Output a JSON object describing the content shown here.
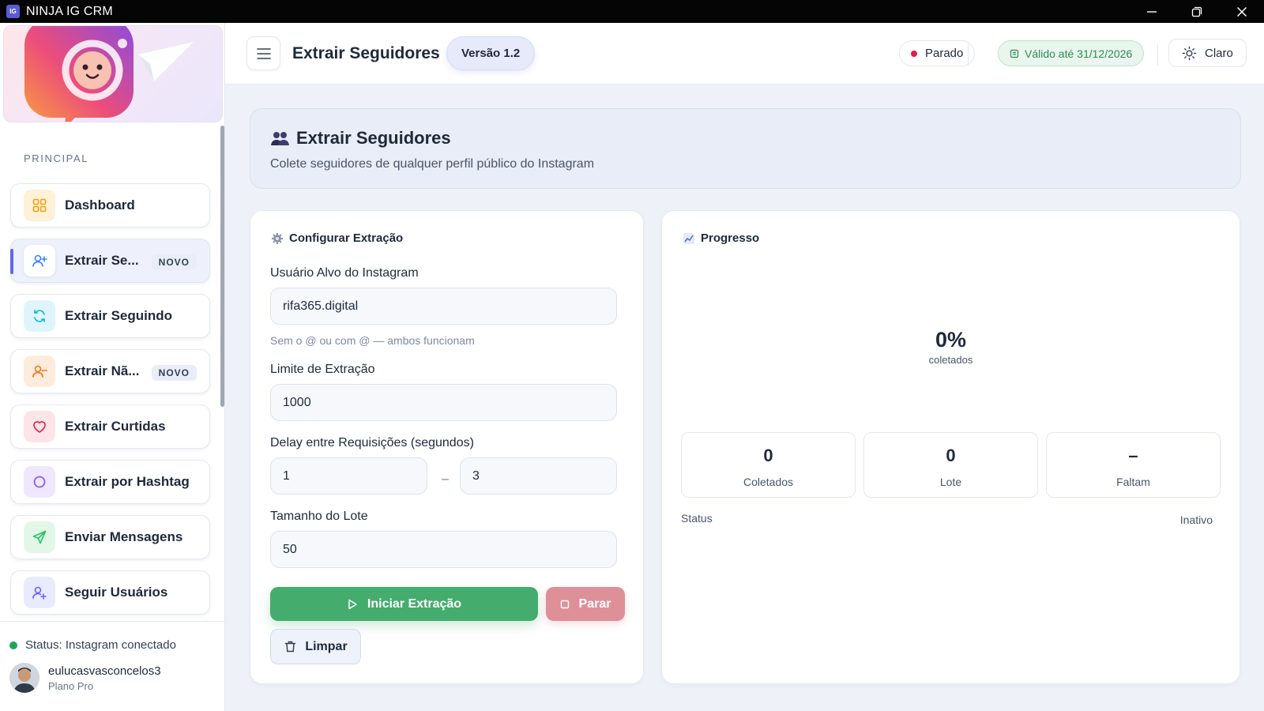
{
  "window": {
    "title": "NINJA IG CRM",
    "logo_text": "IG"
  },
  "sidebar": {
    "section_label": "PRINCIPAL",
    "items": [
      {
        "label": "Dashboard",
        "badge": "",
        "icon": "grid-icon",
        "color": "#f59e0b"
      },
      {
        "label": "Extrair Se...",
        "badge": "NOVO",
        "icon": "user-plus-icon",
        "color": "#3b82f6",
        "active": true
      },
      {
        "label": "Extrair Seguindo",
        "badge": "",
        "icon": "refresh-icon",
        "color": "#06b6d4"
      },
      {
        "label": "Extrair Nã...",
        "badge": "NOVO",
        "icon": "user-minus-icon",
        "color": "#f97316"
      },
      {
        "label": "Extrair Curtidas",
        "badge": "",
        "icon": "heart-icon",
        "color": "#e11d48"
      },
      {
        "label": "Extrair por Hashtag",
        "badge": "",
        "icon": "circle-icon",
        "color": "#8b5cf6"
      },
      {
        "label": "Enviar Mensagens",
        "badge": "",
        "icon": "send-icon",
        "color": "#22c55e"
      },
      {
        "label": "Seguir Usuários",
        "badge": "",
        "icon": "user-add-icon",
        "color": "#6366f1"
      }
    ],
    "status_text": "Status: Instagram conectado",
    "user": {
      "name": "eulucasvasconcelos3",
      "plan": "Plano Pro"
    }
  },
  "header": {
    "title": "Extrair Seguidores",
    "version": "Versão 1.2",
    "state": "Parado",
    "validity": "Válido até 31/12/2026",
    "theme": "Claro"
  },
  "hero": {
    "title": "Extrair Seguidores",
    "subtitle": "Colete seguidores de qualquer perfil público do Instagram"
  },
  "config": {
    "title": "Configurar Extração",
    "target_label": "Usuário Alvo do Instagram",
    "target_value": "rifa365.digital",
    "target_hint": "Sem o @ ou com @ — ambos funcionam",
    "limit_label": "Limite de Extração",
    "limit_value": "1000",
    "delay_label": "Delay entre Requisições (segundos)",
    "delay_min": "1",
    "delay_sep": "–",
    "delay_max": "3",
    "batch_label": "Tamanho do Lote",
    "batch_value": "50",
    "start_label": "Iniciar Extração",
    "stop_label": "Parar",
    "clear_label": "Limpar"
  },
  "progress": {
    "title": "Progresso",
    "percent": "0%",
    "percent_label": "coletados",
    "stats": [
      {
        "value": "0",
        "label": "Coletados"
      },
      {
        "value": "0",
        "label": "Lote"
      },
      {
        "value": "–",
        "label": "Faltam"
      }
    ],
    "status_label": "Status",
    "status_value": "Inativo"
  }
}
